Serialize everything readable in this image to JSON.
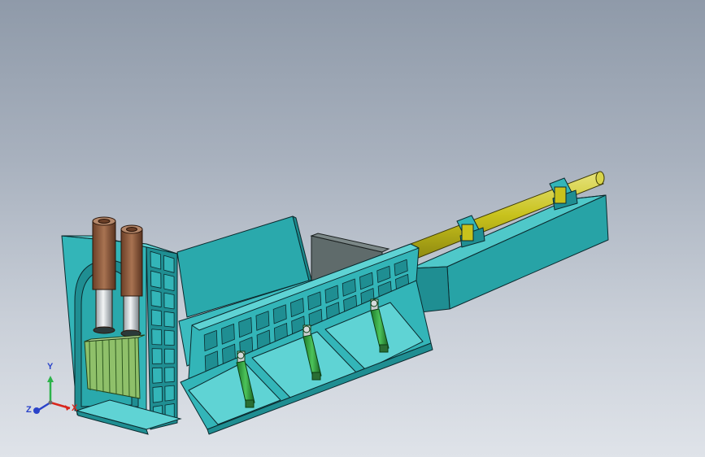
{
  "viewport": {
    "background_top": "#8f9aa9",
    "background_bottom": "#dfe3e9"
  },
  "model": {
    "frame_color": "#33b5b8",
    "frame_shade": "#1f8e92",
    "edge_color": "#0b2a2e",
    "pipe_color": "#c8c21c",
    "cylinder_color": "#2f9f3c",
    "ram_color": "#8a5a3c",
    "press_plate_color": "#8fc06a",
    "side_wall_color": "#5f6b6b"
  },
  "triad": {
    "x_label": "X",
    "y_label": "Y",
    "z_label": "Z",
    "x_color": "#d9261c",
    "y_color": "#2db34a",
    "z_color": "#2a43c9"
  }
}
